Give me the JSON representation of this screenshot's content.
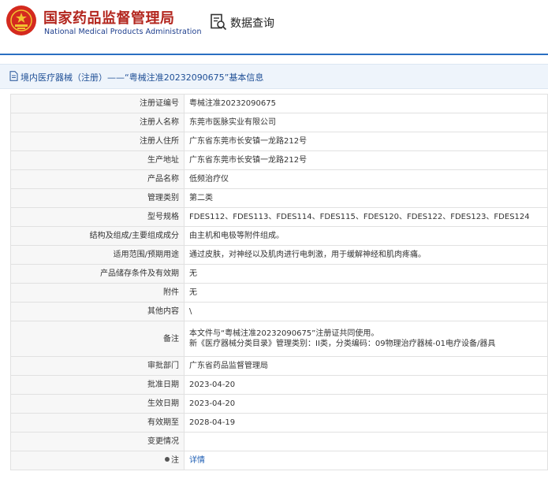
{
  "header": {
    "title_cn": "国家药品监督管理局",
    "title_en": "National Medical Products Administration",
    "query_label": "数据查询",
    "logo_icon": "emblem-icon",
    "query_icon": "document-search-icon"
  },
  "breadcrumb": {
    "text": "境内医疗器械（注册）——“粤械注准20232090675”基本信息"
  },
  "rows": [
    {
      "label": "注册证编号",
      "value": "粤械注准20232090675"
    },
    {
      "label": "注册人名称",
      "value": "东莞市医脉实业有限公司"
    },
    {
      "label": "注册人住所",
      "value": "广东省东莞市长安镇一龙路212号"
    },
    {
      "label": "生产地址",
      "value": "广东省东莞市长安镇一龙路212号"
    },
    {
      "label": "产品名称",
      "value": "低频治疗仪"
    },
    {
      "label": "管理类别",
      "value": "第二类"
    },
    {
      "label": "型号规格",
      "value": "FDES112、FDES113、FDES114、FDES115、FDES120、FDES122、FDES123、FDES124"
    },
    {
      "label": "结构及组成/主要组成成分",
      "value": "由主机和电极等附件组成。"
    },
    {
      "label": "适用范围/预期用途",
      "value": "通过皮肤，对神经以及肌肉进行电刺激，用于缓解神经和肌肉疼痛。"
    },
    {
      "label": "产品储存条件及有效期",
      "value": "无"
    },
    {
      "label": "附件",
      "value": "无"
    },
    {
      "label": "其他内容",
      "value": "\\"
    },
    {
      "label": "备注",
      "value_line1": "本文件与“粤械注准20232090675”注册证共同使用。",
      "value_line2": "新《医疗器械分类目录》管理类别：II类，分类编码：09物理治疗器械-01电疗设备/器具"
    },
    {
      "label": "审批部门",
      "value": "广东省药品监督管理局"
    },
    {
      "label": "批准日期",
      "value": "2023-04-20"
    },
    {
      "label": "生效日期",
      "value": "2023-04-20"
    },
    {
      "label": "有效期至",
      "value": "2028-04-19"
    },
    {
      "label": "变更情况",
      "value": ""
    },
    {
      "label": "注",
      "value": "详情"
    }
  ],
  "colors": {
    "brand_red": "#b3261e",
    "brand_blue": "#1b3c8c",
    "accent_blue": "#2a6fc2",
    "link_blue": "#1f5fb4"
  }
}
